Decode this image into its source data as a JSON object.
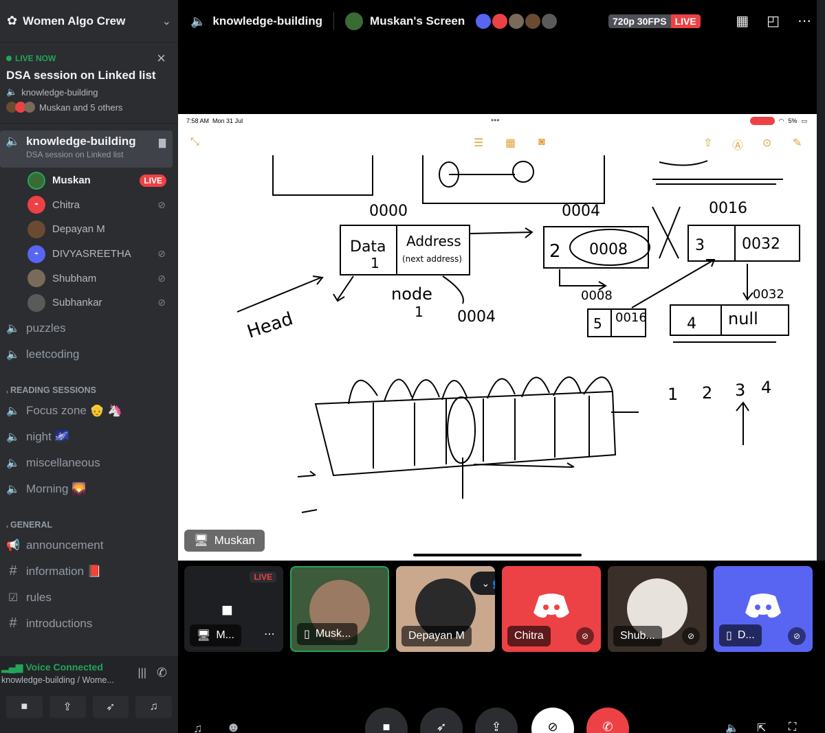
{
  "server": {
    "name": "Women Algo Crew"
  },
  "live_card": {
    "status": "LIVE NOW",
    "title": "DSA session on Linked list",
    "channel": "knowledge-building",
    "viewers": "Muskan and 5 others"
  },
  "active_channel": {
    "name": "knowledge-building",
    "description": "DSA session on Linked list"
  },
  "voice_users": [
    {
      "name": "Muskan",
      "badge": "LIVE",
      "color": "#3a6b35"
    },
    {
      "name": "Chitra",
      "color": "#ed4245"
    },
    {
      "name": "Depayan M",
      "color": "#6b4a32"
    },
    {
      "name": "DIVYASREETHA",
      "color": "#5865f2"
    },
    {
      "name": "Shubham",
      "color": "#7a6a5a"
    },
    {
      "name": "Subhankar",
      "color": "#5a5a5a"
    }
  ],
  "channels_a": [
    {
      "name": "puzzles"
    },
    {
      "name": "leetcoding"
    }
  ],
  "category_reading": "READING SESSIONS",
  "channels_reading": [
    {
      "name": "Focus zone",
      "emoji": "👴 🦄"
    },
    {
      "name": "night",
      "emoji": "🌌"
    },
    {
      "name": "miscellaneous",
      "emoji": ""
    },
    {
      "name": "Morning",
      "emoji": "🌄"
    }
  ],
  "category_general": "GENERAL",
  "channels_general": [
    {
      "name": "announcement",
      "icon": "📢"
    },
    {
      "name": "information",
      "icon": "#",
      "emoji": "📕"
    },
    {
      "name": "rules",
      "icon": "☑"
    },
    {
      "name": "introductions",
      "icon": "#"
    }
  ],
  "voice_bar": {
    "status": "Voice Connected",
    "location": "knowledge-building / Wome..."
  },
  "topbar": {
    "channel": "knowledge-building",
    "screen": "Muskan's Screen",
    "quality": "720p 30FPS",
    "live": "LIVE"
  },
  "screen": {
    "time": "7:58 AM",
    "date": "Mon 31 Jul",
    "battery": "5%",
    "presenter": "Muskan"
  },
  "whiteboard": {
    "addr1": "0000",
    "addr2": "0004",
    "addr3": "0016",
    "data_label": "Data",
    "data_val": "1",
    "address_label": "Address",
    "next_label": "(next address)",
    "node_label": "node",
    "node_val": "1",
    "addr_0004": "0004",
    "head": "Head",
    "n2_data": "2",
    "n2_addr": "0008",
    "n3_data": "3",
    "n3_addr": "0032",
    "addr_0008": "0008",
    "n4_data": "5",
    "n4_addr": "0016",
    "addr_0032": "0032",
    "n5_data": "4",
    "n5_addr": "null",
    "seq": [
      "1",
      "2",
      "3",
      "4"
    ]
  },
  "tiles": [
    {
      "name": "M...",
      "badge": "LIVE",
      "color": "#1e1f22"
    },
    {
      "name": "Musk...",
      "color": "#3d5a3a"
    },
    {
      "name": "Depayan M",
      "color": "#c9a88e"
    },
    {
      "name": "Chitra",
      "color": "#ed4245"
    },
    {
      "name": "Shub...",
      "color": "#3b3029"
    },
    {
      "name": "D...",
      "color": "#5865f2"
    }
  ]
}
